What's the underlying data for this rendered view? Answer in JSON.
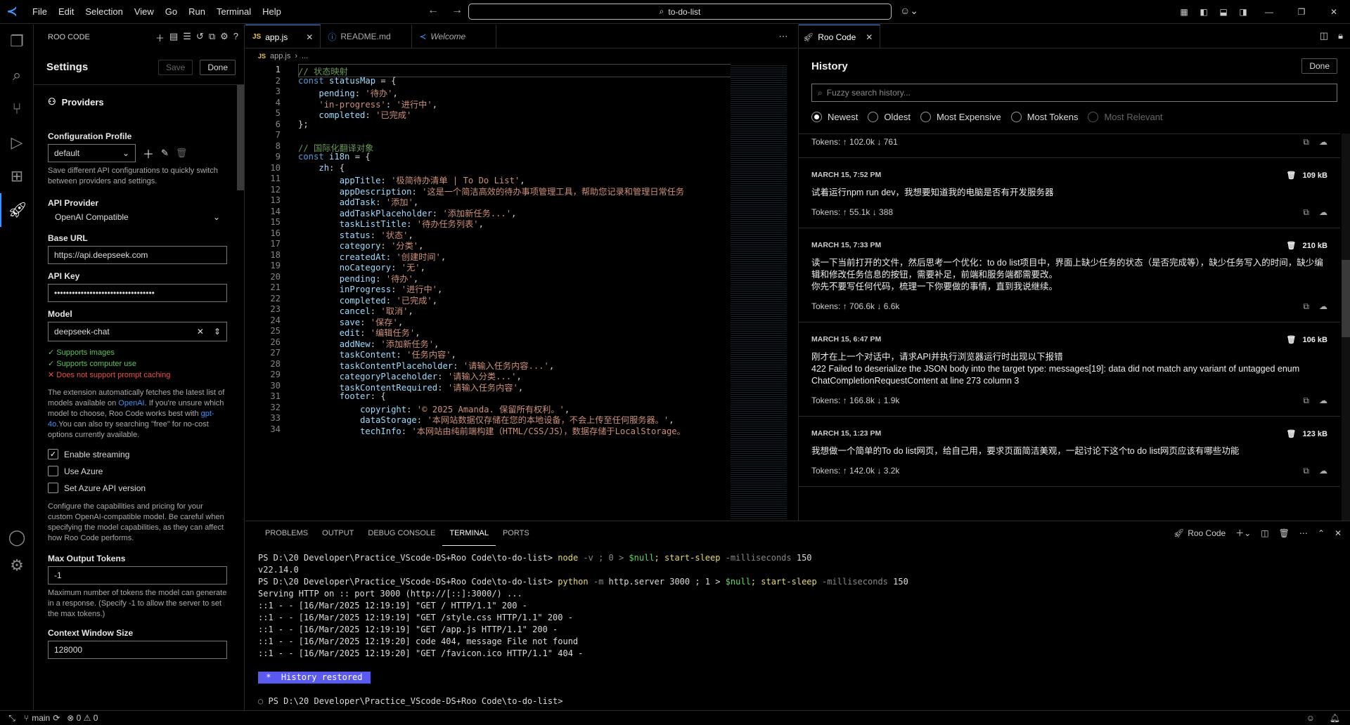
{
  "menu": [
    "File",
    "Edit",
    "Selection",
    "View",
    "Go",
    "Run",
    "Terminal",
    "Help"
  ],
  "search_box": "to-do-list",
  "sidebar": {
    "title": "ROO CODE",
    "settings_title": "Settings",
    "save_label": "Save",
    "done_label": "Done",
    "providers_label": "Providers",
    "config_profile_label": "Configuration Profile",
    "config_profile_value": "default",
    "config_profile_desc": "Save different API configurations to quickly switch between providers and settings.",
    "api_provider_label": "API Provider",
    "api_provider_value": "OpenAI Compatible",
    "base_url_label": "Base URL",
    "base_url_value": "https://api.deepseek.com",
    "api_key_label": "API Key",
    "api_key_value": "••••••••••••••••••••••••••••••••••",
    "model_label": "Model",
    "model_value": "deepseek-chat",
    "cap1": "Supports images",
    "cap2": "Supports computer use",
    "cap3": "Does not support prompt caching",
    "fetch_desc_1": "The extension automatically fetches the latest list of models available on ",
    "fetch_link_1": "OpenAI",
    "fetch_desc_2": ". If you're unsure which model to choose, Roo Code works best with ",
    "fetch_link_2": "gpt-4o",
    "fetch_desc_3": ".You can also try searching \"free\" for no-cost options currently available.",
    "enable_streaming": "Enable streaming",
    "use_azure": "Use Azure",
    "set_azure": "Set Azure API version",
    "capabilities_desc": "Configure the capabilities and pricing for your custom OpenAI-compatible model. Be careful when specifying the model capabilities, as they can affect how Roo Code performs.",
    "max_output_label": "Max Output Tokens",
    "max_output_value": "-1",
    "max_output_desc": "Maximum number of tokens the model can generate in a response. (Specify -1 to allow the server to set the max tokens.)",
    "context_window_label": "Context Window Size",
    "context_window_value": "128000"
  },
  "editor": {
    "tabs": [
      {
        "label": "app.js",
        "icon": "JS"
      },
      {
        "label": "README.md",
        "icon": "ⓘ"
      },
      {
        "label": "Welcome",
        "icon": "≺"
      }
    ],
    "breadcrumb_file": "app.js",
    "breadcrumb_rest": "...",
    "lines": [
      [
        [
          "cmt",
          "// 状态映射"
        ]
      ],
      [
        [
          "kw",
          "const "
        ],
        [
          "prop",
          "statusMap"
        ],
        [
          "pun",
          " = {"
        ]
      ],
      [
        [
          "pun",
          "    "
        ],
        [
          "prop",
          "pending"
        ],
        [
          "pun",
          ": "
        ],
        [
          "str",
          "'待办'"
        ],
        [
          "pun",
          ","
        ]
      ],
      [
        [
          "pun",
          "    "
        ],
        [
          "str",
          "'in-progress'"
        ],
        [
          "pun",
          ": "
        ],
        [
          "str",
          "'进行中'"
        ],
        [
          "pun",
          ","
        ]
      ],
      [
        [
          "pun",
          "    "
        ],
        [
          "prop",
          "completed"
        ],
        [
          "pun",
          ": "
        ],
        [
          "str",
          "'已完成'"
        ]
      ],
      [
        [
          "pun",
          "};"
        ]
      ],
      [
        [
          "pun",
          ""
        ]
      ],
      [
        [
          "cmt",
          "// 国际化翻译对象"
        ]
      ],
      [
        [
          "kw",
          "const "
        ],
        [
          "prop",
          "i18n"
        ],
        [
          "pun",
          " = {"
        ]
      ],
      [
        [
          "pun",
          "    "
        ],
        [
          "prop",
          "zh"
        ],
        [
          "pun",
          ": {"
        ]
      ],
      [
        [
          "pun",
          "        "
        ],
        [
          "prop",
          "appTitle"
        ],
        [
          "pun",
          ": "
        ],
        [
          "str",
          "'极简待办清单 | To Do List'"
        ],
        [
          "pun",
          ","
        ]
      ],
      [
        [
          "pun",
          "        "
        ],
        [
          "prop",
          "appDescription"
        ],
        [
          "pun",
          ": "
        ],
        [
          "str",
          "'这是一个简洁高效的待办事项管理工具，帮助您记录和管理日常任务"
        ]
      ],
      [
        [
          "pun",
          "        "
        ],
        [
          "prop",
          "addTask"
        ],
        [
          "pun",
          ": "
        ],
        [
          "str",
          "'添加'"
        ],
        [
          "pun",
          ","
        ]
      ],
      [
        [
          "pun",
          "        "
        ],
        [
          "prop",
          "addTaskPlaceholder"
        ],
        [
          "pun",
          ": "
        ],
        [
          "str",
          "'添加新任务...'"
        ],
        [
          "pun",
          ","
        ]
      ],
      [
        [
          "pun",
          "        "
        ],
        [
          "prop",
          "taskListTitle"
        ],
        [
          "pun",
          ": "
        ],
        [
          "str",
          "'待办任务列表'"
        ],
        [
          "pun",
          ","
        ]
      ],
      [
        [
          "pun",
          "        "
        ],
        [
          "prop",
          "status"
        ],
        [
          "pun",
          ": "
        ],
        [
          "str",
          "'状态'"
        ],
        [
          "pun",
          ","
        ]
      ],
      [
        [
          "pun",
          "        "
        ],
        [
          "prop",
          "category"
        ],
        [
          "pun",
          ": "
        ],
        [
          "str",
          "'分类'"
        ],
        [
          "pun",
          ","
        ]
      ],
      [
        [
          "pun",
          "        "
        ],
        [
          "prop",
          "createdAt"
        ],
        [
          "pun",
          ": "
        ],
        [
          "str",
          "'创建时间'"
        ],
        [
          "pun",
          ","
        ]
      ],
      [
        [
          "pun",
          "        "
        ],
        [
          "prop",
          "noCategory"
        ],
        [
          "pun",
          ": "
        ],
        [
          "str",
          "'无'"
        ],
        [
          "pun",
          ","
        ]
      ],
      [
        [
          "pun",
          "        "
        ],
        [
          "prop",
          "pending"
        ],
        [
          "pun",
          ": "
        ],
        [
          "str",
          "'待办'"
        ],
        [
          "pun",
          ","
        ]
      ],
      [
        [
          "pun",
          "        "
        ],
        [
          "prop",
          "inProgress"
        ],
        [
          "pun",
          ": "
        ],
        [
          "str",
          "'进行中'"
        ],
        [
          "pun",
          ","
        ]
      ],
      [
        [
          "pun",
          "        "
        ],
        [
          "prop",
          "completed"
        ],
        [
          "pun",
          ": "
        ],
        [
          "str",
          "'已完成'"
        ],
        [
          "pun",
          ","
        ]
      ],
      [
        [
          "pun",
          "        "
        ],
        [
          "prop",
          "cancel"
        ],
        [
          "pun",
          ": "
        ],
        [
          "str",
          "'取消'"
        ],
        [
          "pun",
          ","
        ]
      ],
      [
        [
          "pun",
          "        "
        ],
        [
          "prop",
          "save"
        ],
        [
          "pun",
          ": "
        ],
        [
          "str",
          "'保存'"
        ],
        [
          "pun",
          ","
        ]
      ],
      [
        [
          "pun",
          "        "
        ],
        [
          "prop",
          "edit"
        ],
        [
          "pun",
          ": "
        ],
        [
          "str",
          "'编辑任务'"
        ],
        [
          "pun",
          ","
        ]
      ],
      [
        [
          "pun",
          "        "
        ],
        [
          "prop",
          "addNew"
        ],
        [
          "pun",
          ": "
        ],
        [
          "str",
          "'添加新任务'"
        ],
        [
          "pun",
          ","
        ]
      ],
      [
        [
          "pun",
          "        "
        ],
        [
          "prop",
          "taskContent"
        ],
        [
          "pun",
          ": "
        ],
        [
          "str",
          "'任务内容'"
        ],
        [
          "pun",
          ","
        ]
      ],
      [
        [
          "pun",
          "        "
        ],
        [
          "prop",
          "taskContentPlaceholder"
        ],
        [
          "pun",
          ": "
        ],
        [
          "str",
          "'请输入任务内容...'"
        ],
        [
          "pun",
          ","
        ]
      ],
      [
        [
          "pun",
          "        "
        ],
        [
          "prop",
          "categoryPlaceholder"
        ],
        [
          "pun",
          ": "
        ],
        [
          "str",
          "'请输入分类...'"
        ],
        [
          "pun",
          ","
        ]
      ],
      [
        [
          "pun",
          "        "
        ],
        [
          "prop",
          "taskContentRequired"
        ],
        [
          "pun",
          ": "
        ],
        [
          "str",
          "'请输入任务内容'"
        ],
        [
          "pun",
          ","
        ]
      ],
      [
        [
          "pun",
          "        "
        ],
        [
          "prop",
          "footer"
        ],
        [
          "pun",
          ": {"
        ]
      ],
      [
        [
          "pun",
          "            "
        ],
        [
          "prop",
          "copyright"
        ],
        [
          "pun",
          ": "
        ],
        [
          "str",
          "'© 2025 Amanda. 保留所有权利。'"
        ],
        [
          "pun",
          ","
        ]
      ],
      [
        [
          "pun",
          "            "
        ],
        [
          "prop",
          "dataStorage"
        ],
        [
          "pun",
          ": "
        ],
        [
          "str",
          "'本网站数据仅存储在您的本地设备，不会上传至任何服务器。'"
        ],
        [
          "pun",
          ","
        ]
      ],
      [
        [
          "pun",
          "            "
        ],
        [
          "prop",
          "techInfo"
        ],
        [
          "pun",
          ": "
        ],
        [
          "str",
          "'本网站由纯前端构建（HTML/CSS/JS），数据存储于LocalStorage。"
        ]
      ]
    ]
  },
  "roo": {
    "tab_label": "Roo Code",
    "history_title": "History",
    "done_label": "Done",
    "search_placeholder": "Fuzzy search history...",
    "sort_options": [
      "Newest",
      "Oldest",
      "Most Expensive",
      "Most Tokens",
      "Most Relevant"
    ],
    "first_tokens": "Tokens: ↑ 102.0k ↓ 761",
    "items": [
      {
        "date": "MARCH 15, 7:52 PM",
        "size": "109 kB",
        "task": "试着运行npm run dev，我想要知道我的电脑是否有开发服务器",
        "tokens": "Tokens: ↑ 55.1k ↓ 388"
      },
      {
        "date": "MARCH 15, 7:33 PM",
        "size": "210 kB",
        "task": "读一下当前打开的文件，然后思考一个优化：to do list项目中，界面上缺少任务的状态（是否完成等），缺少任务写入的时间，缺少编辑和修改任务信息的按钮，需要补足，前端和服务端都需要改。\n你先不要写任何代码，梳理一下你要做的事情，直到我说继续。",
        "tokens": "Tokens: ↑ 706.6k ↓ 6.6k"
      },
      {
        "date": "MARCH 15, 6:47 PM",
        "size": "106 kB",
        "task": "刚才在上一个对话中，请求API并执行浏览器运行时出现以下报错\n422 Failed to deserialize the JSON body into the target type: messages[19]: data did not match any variant of untagged enum ChatCompletionRequestContent at line 273 column 3",
        "tokens": "Tokens: ↑ 166.8k ↓ 1.9k"
      },
      {
        "date": "MARCH 15, 1:23 PM",
        "size": "123 kB",
        "task": "我想做一个简单的To do list网页，给自己用，要求页面简洁美观，一起讨论下这个to do list网页应该有哪些功能",
        "tokens": "Tokens: ↑ 142.0k ↓ 3.2k"
      }
    ]
  },
  "panel": {
    "tabs": [
      "PROBLEMS",
      "OUTPUT",
      "DEBUG CONSOLE",
      "TERMINAL",
      "PORTS"
    ],
    "terminal_name": "Roo Code",
    "prompt": "PS D:\\20 Developer\\Practice_VScode-DS+Roo Code\\to-do-list>",
    "cmd1": "node",
    "cmd1_args": " -v ; 0 > ",
    "cmd1_null": "$null",
    "cmd1_sleep": "; start-sleep",
    "cmd1_ms": " -milliseconds ",
    "cmd1_val": "150",
    "out1": "v22.14.0",
    "cmd2": "python",
    "cmd2_args": " -m ",
    "cmd2_rest": "http.server 3000 ; 1 > ",
    "cmd2_null": "$null",
    "cmd2_sleep": "; start-sleep",
    "cmd2_ms": " -milliseconds ",
    "cmd2_val": "150",
    "out_lines": [
      "Serving HTTP on :: port 3000 (http://[::]:3000/) ...",
      "::1 - - [16/Mar/2025 12:19:19] \"GET / HTTP/1.1\" 200 -",
      "::1 - - [16/Mar/2025 12:19:19] \"GET /style.css HTTP/1.1\" 200 -",
      "::1 - - [16/Mar/2025 12:19:19] \"GET /app.js HTTP/1.1\" 200 -",
      "::1 - - [16/Mar/2025 12:19:20] code 404, message File not found",
      "::1 - - [16/Mar/2025 12:19:20] \"GET /favicon.ico HTTP/1.1\" 404 -"
    ],
    "restored": " *  History restored ",
    "final_prompt": "PS D:\\20 Developer\\Practice_VScode-DS+Roo Code\\to-do-list>"
  },
  "status": {
    "branch": "main",
    "problems": "⊗ 0 ⚠ 0"
  }
}
